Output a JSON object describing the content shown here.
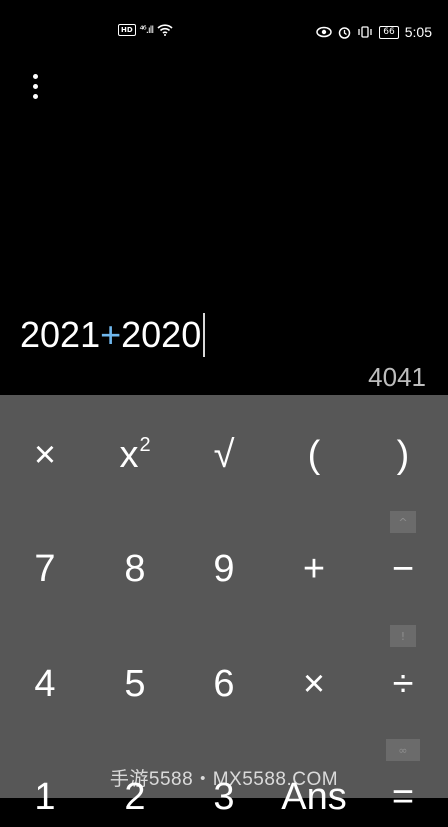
{
  "status_bar": {
    "hd": "HD",
    "signal": "⁴⁶.ıll",
    "battery": "66",
    "time": "5:05"
  },
  "display": {
    "expr_a": "2021",
    "expr_op": "+",
    "expr_b": "2020",
    "result": "4041"
  },
  "keys": {
    "row1": [
      "×",
      "x",
      "√",
      "(",
      ")"
    ],
    "square_sup": "2",
    "row2": [
      "7",
      "8",
      "9",
      "+",
      "−"
    ],
    "row3": [
      "4",
      "5",
      "6",
      "×",
      "÷"
    ],
    "row4": [
      "1",
      "2",
      "3",
      "Ans",
      "="
    ]
  },
  "chips": [
    "^",
    "!",
    "∞"
  ],
  "watermark": "手游5588・MX5588.COM",
  "colors": {
    "accent": "#6fb7ec",
    "keypad_bg": "#575757",
    "display_bg": "#000000"
  }
}
